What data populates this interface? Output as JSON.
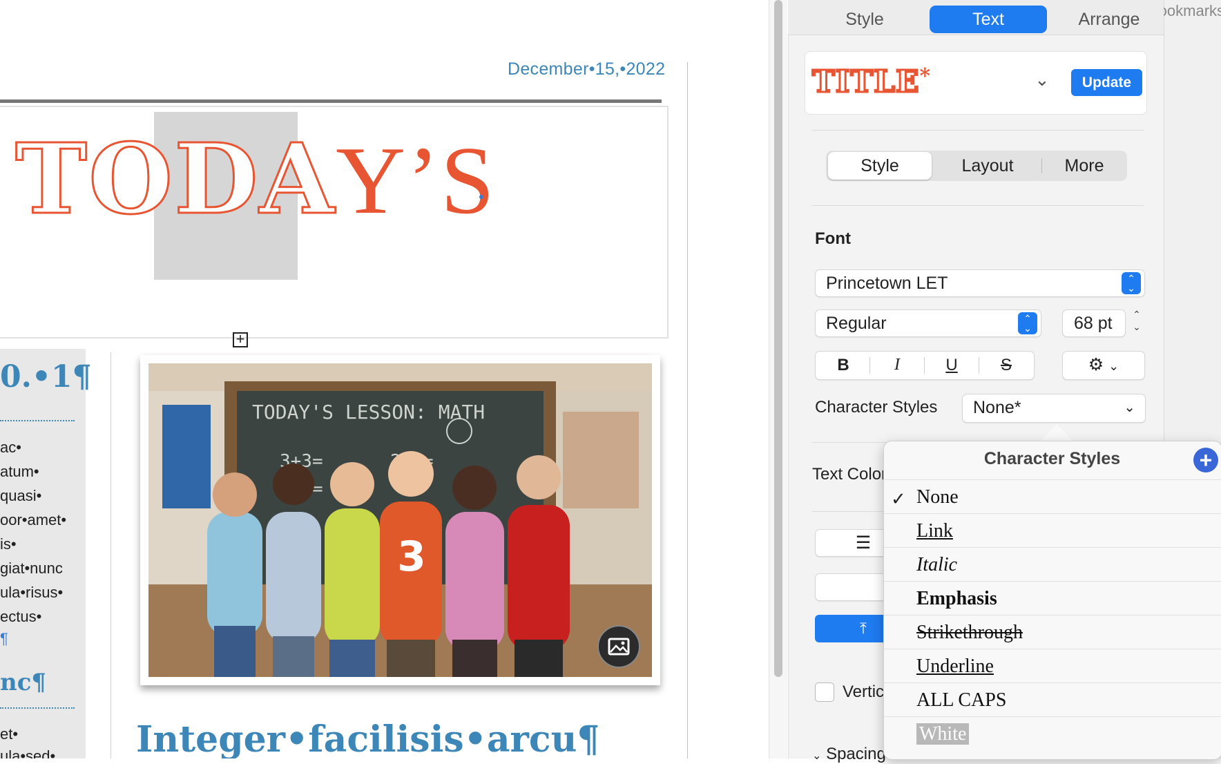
{
  "document": {
    "date": "December•15,•2022",
    "title_prefix": "TO",
    "title_highlight": "DA",
    "title_suffix": "Y’S",
    "sidebar_heading_1": "0.•1¶",
    "sidebar_lines": [
      "ac•",
      "atum•",
      "quasi•",
      "oor•amet•",
      "is•",
      "giat•nunc",
      "ula•risus•",
      "ectus•",
      "¶"
    ],
    "sidebar_heading_2": "nc¶",
    "sidebar_lines_2": [
      "et•",
      "ula•sed•"
    ],
    "body_heading": "Integer•facilisis•arcu¶"
  },
  "panel": {
    "tabs": [
      {
        "label": "Style",
        "active": false
      },
      {
        "label": "Text",
        "active": true
      },
      {
        "label": "Arrange",
        "active": false
      }
    ],
    "bookmarks_tab": "Bookmarks",
    "paragraph_style": "TITLE",
    "paragraph_style_modified": "*",
    "update_label": "Update",
    "subtabs": [
      {
        "label": "Style",
        "active": true
      },
      {
        "label": "Layout",
        "active": false
      },
      {
        "label": "More",
        "active": false
      }
    ],
    "font_section": "Font",
    "font_family": "Princetown LET",
    "font_typeface": "Regular",
    "font_size": "68 pt",
    "bold_label": "B",
    "italic_label": "I",
    "underline_label": "U",
    "strike_label": "S",
    "char_styles_label": "Character Styles",
    "char_styles_value": "None*",
    "text_color_label": "Text Color",
    "vertical_label": "Vertical",
    "spacing_label": "Spacing"
  },
  "popover": {
    "title": "Character Styles",
    "add_icon": "plus-icon",
    "items": [
      {
        "label": "None",
        "checked": true,
        "style": "normal"
      },
      {
        "label": "Link",
        "checked": false,
        "style": "underline"
      },
      {
        "label": "Italic",
        "checked": false,
        "style": "italic"
      },
      {
        "label": "Emphasis",
        "checked": false,
        "style": "bold"
      },
      {
        "label": "Strikethrough",
        "checked": false,
        "style": "strike"
      },
      {
        "label": "Underline",
        "checked": false,
        "style": "underline"
      },
      {
        "label": "ALL CAPS",
        "checked": false,
        "style": "normal"
      },
      {
        "label": "White",
        "checked": false,
        "style": "white"
      }
    ]
  },
  "colors": {
    "accent": "#1f7bf0",
    "title_red": "#e85532",
    "doc_blue": "#3d87b8"
  }
}
